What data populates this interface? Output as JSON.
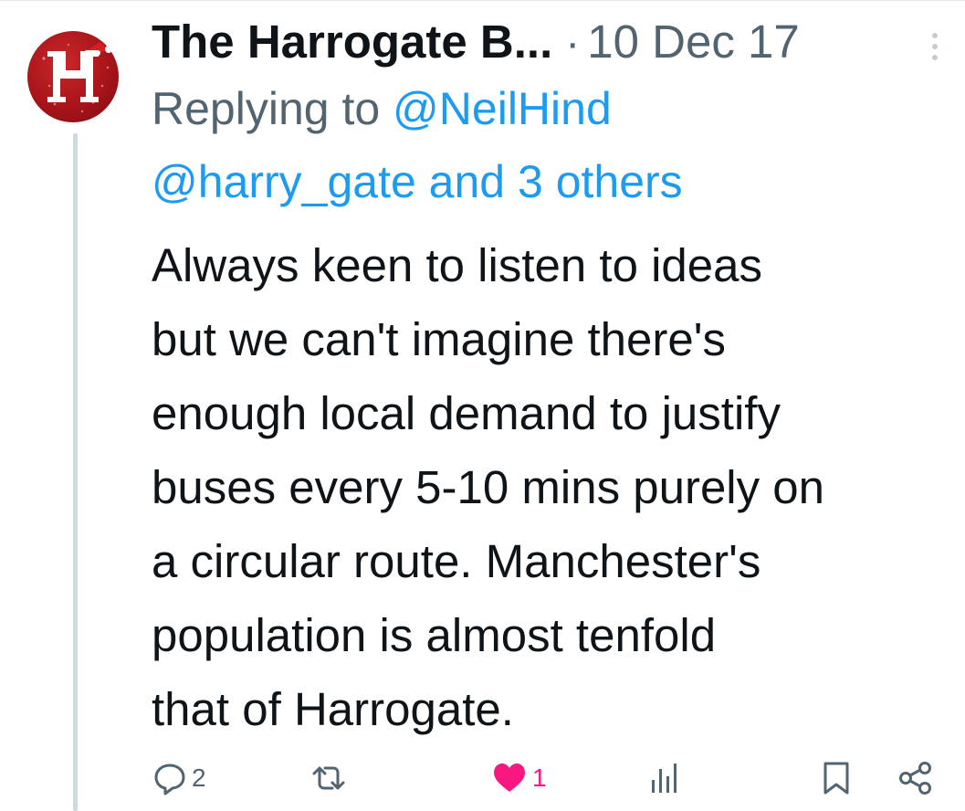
{
  "tweet": {
    "author_name": "The Harrogate B...",
    "separator": "·",
    "date": "10 Dec 17",
    "avatar_letter": "H",
    "replying_prefix": "Replying to ",
    "replying_handle": "@NeilHind",
    "replying_others": "@harry_gate and 3 others",
    "body_lines": [
      "Always keen to listen to ideas",
      "but we can't imagine there's",
      "enough local demand to justify",
      "buses every 5-10 mins purely on",
      "a circular route. Manchester's",
      "population is almost tenfold",
      "that of Harrogate."
    ]
  },
  "actions": {
    "reply": {
      "icon": "reply-icon",
      "count": "2"
    },
    "retweet": {
      "icon": "retweet-icon",
      "count": ""
    },
    "like": {
      "icon": "heart-icon",
      "count": "1",
      "color": "#f91880"
    },
    "views": {
      "icon": "analytics-icon",
      "count": ""
    },
    "bookmark": {
      "icon": "bookmark-icon"
    },
    "share": {
      "icon": "share-icon"
    }
  },
  "colors": {
    "text": "#0f1419",
    "secondary": "#536471",
    "link": "#1d9bf0",
    "like": "#f91880",
    "avatar": "#a8141a"
  }
}
